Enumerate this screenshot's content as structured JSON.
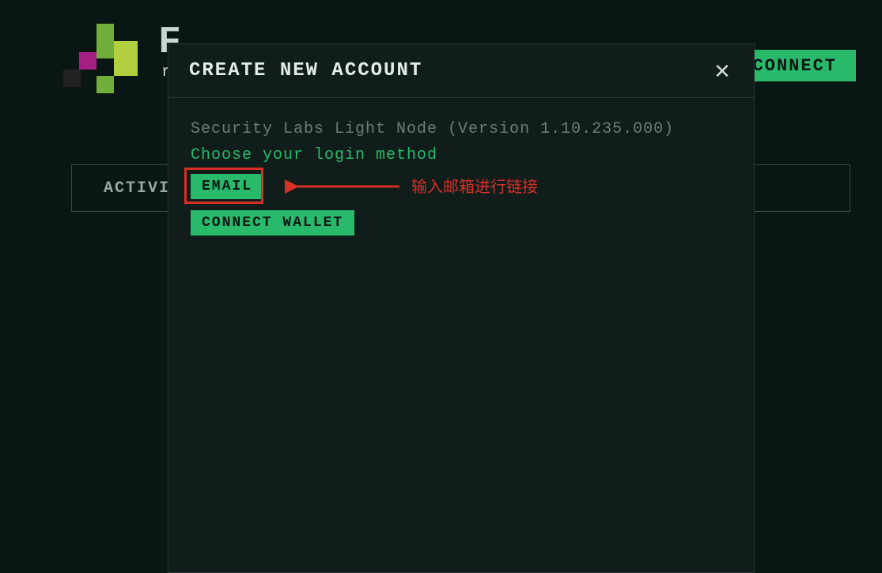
{
  "header": {
    "title_fragment": "F",
    "subtitle_fragment": "r",
    "connect_label": "CONNECT"
  },
  "tabs": {
    "item0_fragment": "ACTIVI"
  },
  "modal": {
    "title": "CREATE NEW ACCOUNT",
    "version_line": "Security Labs Light Node (Version 1.10.235.000)",
    "choose_line": "Choose your login method",
    "email_label": "EMAIL",
    "wallet_label": "CONNECT WALLET"
  },
  "annotation": {
    "text": "输入邮箱进行链接"
  }
}
